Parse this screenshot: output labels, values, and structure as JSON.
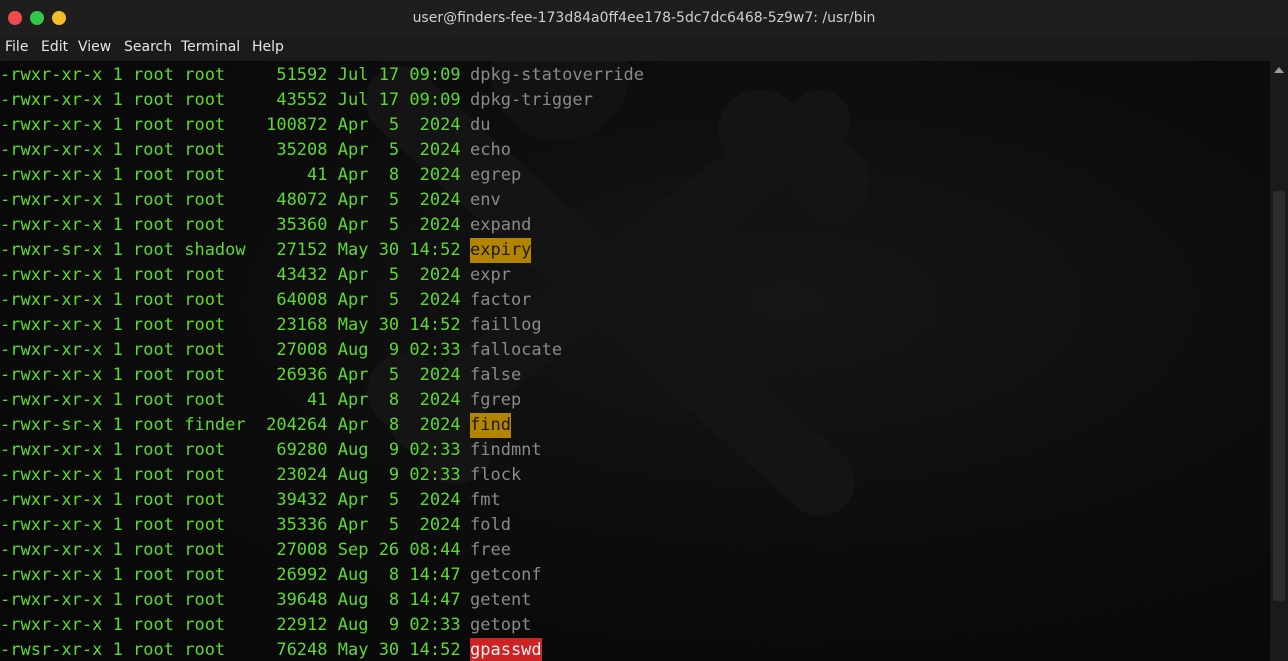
{
  "window": {
    "title": "user@finders-fee-173d84a0ff4ee178-5dc7dc6468-5z9w7: /usr/bin"
  },
  "menu": [
    "File",
    "Edit",
    "View",
    "Search",
    "Terminal",
    "Help"
  ],
  "colors": {
    "meta_text": "#5dd932",
    "filename_text": "#8a8a8a",
    "setgid_highlight": "#b28400",
    "setuid_highlight": "#cc2424"
  },
  "listing": [
    {
      "meta": "-rwxr-xr-x 1 root root     51592 Jul 17 09:09",
      "name": "dpkg-statoverride",
      "highlight": "none"
    },
    {
      "meta": "-rwxr-xr-x 1 root root     43552 Jul 17 09:09",
      "name": "dpkg-trigger",
      "highlight": "none"
    },
    {
      "meta": "-rwxr-xr-x 1 root root    100872 Apr  5  2024",
      "name": "du",
      "highlight": "none"
    },
    {
      "meta": "-rwxr-xr-x 1 root root     35208 Apr  5  2024",
      "name": "echo",
      "highlight": "none"
    },
    {
      "meta": "-rwxr-xr-x 1 root root        41 Apr  8  2024",
      "name": "egrep",
      "highlight": "none"
    },
    {
      "meta": "-rwxr-xr-x 1 root root     48072 Apr  5  2024",
      "name": "env",
      "highlight": "none"
    },
    {
      "meta": "-rwxr-xr-x 1 root root     35360 Apr  5  2024",
      "name": "expand",
      "highlight": "none"
    },
    {
      "meta": "-rwxr-sr-x 1 root shadow   27152 May 30 14:52",
      "name": "expiry",
      "highlight": "setgid"
    },
    {
      "meta": "-rwxr-xr-x 1 root root     43432 Apr  5  2024",
      "name": "expr",
      "highlight": "none"
    },
    {
      "meta": "-rwxr-xr-x 1 root root     64008 Apr  5  2024",
      "name": "factor",
      "highlight": "none"
    },
    {
      "meta": "-rwxr-xr-x 1 root root     23168 May 30 14:52",
      "name": "faillog",
      "highlight": "none"
    },
    {
      "meta": "-rwxr-xr-x 1 root root     27008 Aug  9 02:33",
      "name": "fallocate",
      "highlight": "none"
    },
    {
      "meta": "-rwxr-xr-x 1 root root     26936 Apr  5  2024",
      "name": "false",
      "highlight": "none"
    },
    {
      "meta": "-rwxr-xr-x 1 root root        41 Apr  8  2024",
      "name": "fgrep",
      "highlight": "none"
    },
    {
      "meta": "-rwxr-sr-x 1 root finder  204264 Apr  8  2024",
      "name": "find",
      "highlight": "setgid"
    },
    {
      "meta": "-rwxr-xr-x 1 root root     69280 Aug  9 02:33",
      "name": "findmnt",
      "highlight": "none"
    },
    {
      "meta": "-rwxr-xr-x 1 root root     23024 Aug  9 02:33",
      "name": "flock",
      "highlight": "none"
    },
    {
      "meta": "-rwxr-xr-x 1 root root     39432 Apr  5  2024",
      "name": "fmt",
      "highlight": "none"
    },
    {
      "meta": "-rwxr-xr-x 1 root root     35336 Apr  5  2024",
      "name": "fold",
      "highlight": "none"
    },
    {
      "meta": "-rwxr-xr-x 1 root root     27008 Sep 26 08:44",
      "name": "free",
      "highlight": "none"
    },
    {
      "meta": "-rwxr-xr-x 1 root root     26992 Aug  8 14:47",
      "name": "getconf",
      "highlight": "none"
    },
    {
      "meta": "-rwxr-xr-x 1 root root     39648 Aug  8 14:47",
      "name": "getent",
      "highlight": "none"
    },
    {
      "meta": "-rwxr-xr-x 1 root root     22912 Aug  9 02:33",
      "name": "getopt",
      "highlight": "none"
    },
    {
      "meta": "-rwsr-xr-x 1 root root     76248 May 30 14:52",
      "name": "gpasswd",
      "highlight": "setuid"
    }
  ]
}
